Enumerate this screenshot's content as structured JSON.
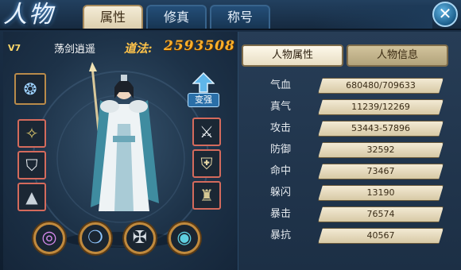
{
  "window": {
    "title_logo": "人物",
    "tabs": [
      {
        "label": "属性",
        "active": true
      },
      {
        "label": "修真",
        "active": false
      },
      {
        "label": "称号",
        "active": false
      }
    ],
    "close_icon": "close-icon"
  },
  "character": {
    "level": "V7",
    "name": "荡剑逍遥",
    "power_label": "道法:",
    "power_value": "2593508",
    "upgrade_label": "变强"
  },
  "equipment": {
    "left": [
      "soul-orb-icon",
      "amulet-icon",
      "armor-sleeve-icon",
      "boots-icon"
    ],
    "right": [
      "sword-icon",
      "shoulder-icon",
      "helmet-icon"
    ],
    "bottom": [
      "ring-icon",
      "necklace-icon",
      "talisman-icon",
      "jade-disc-icon"
    ]
  },
  "subtabs": [
    {
      "label": "人物属性",
      "active": true
    },
    {
      "label": "人物信息",
      "active": false
    }
  ],
  "stats": [
    {
      "label": "气血",
      "value": "680480/709633"
    },
    {
      "label": "真气",
      "value": "11239/12269"
    },
    {
      "label": "攻击",
      "value": "53443-57896"
    },
    {
      "label": "防御",
      "value": "32592"
    },
    {
      "label": "命中",
      "value": "73467"
    },
    {
      "label": "躲闪",
      "value": "13190"
    },
    {
      "label": "暴击",
      "value": "76574"
    },
    {
      "label": "暴抗",
      "value": "40567"
    }
  ],
  "colors": {
    "accent_gold": "#ffb02a",
    "tab_active": "#f4ecd7",
    "bg": "#16283d"
  }
}
